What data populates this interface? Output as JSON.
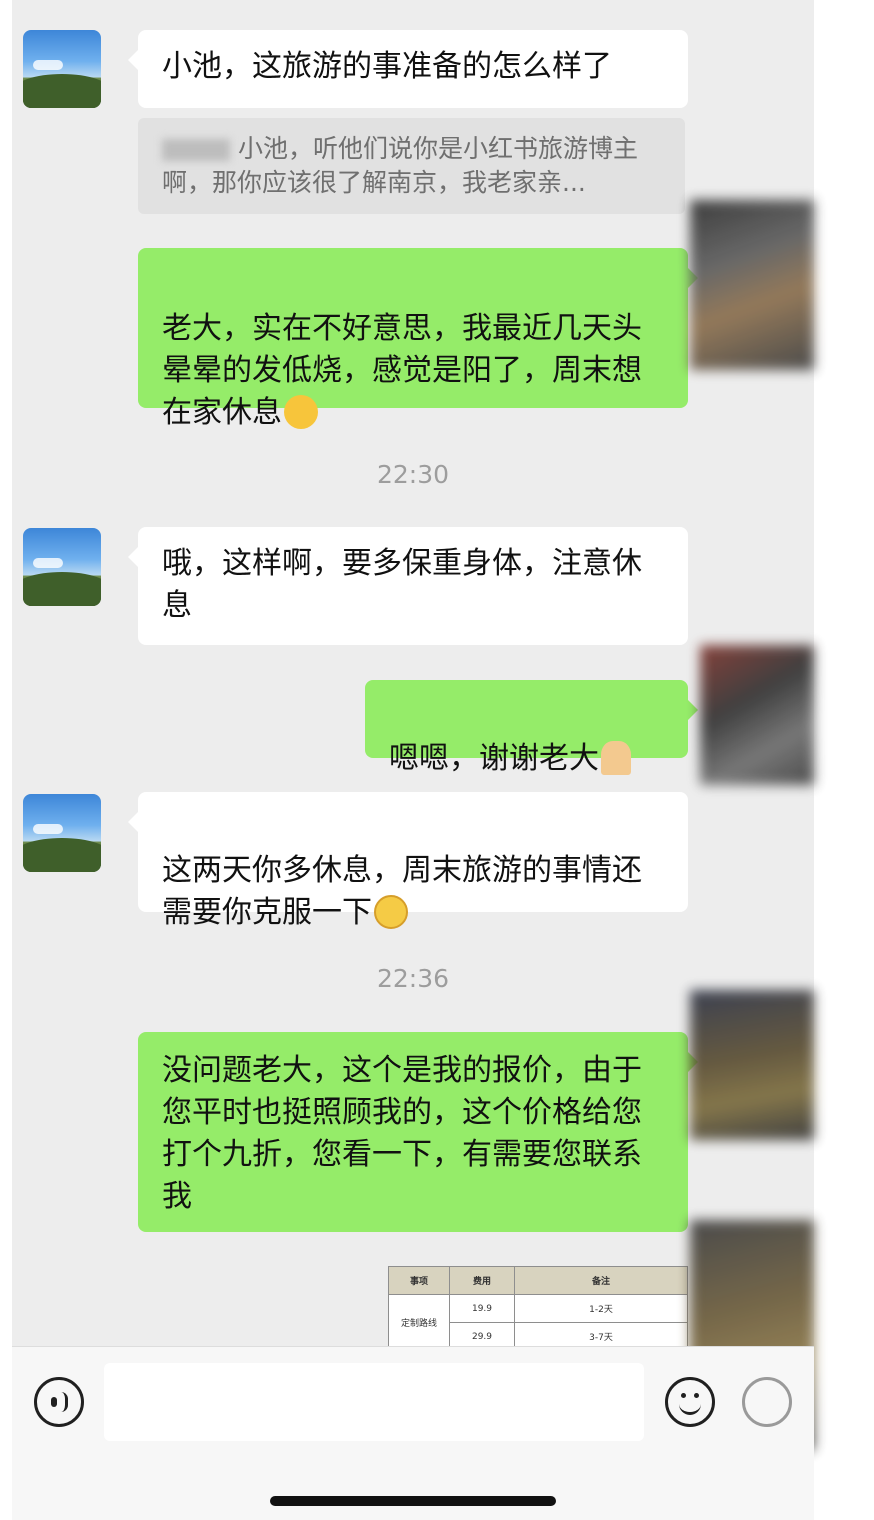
{
  "messages": {
    "m1": "小池，这旅游的事准备的怎么样了",
    "quote_text": "小池，听他们说你是小红书旅游博主啊，那你应该很了解南京，我老家亲...",
    "m2": "老大，实在不好意思，我最近几天头晕晕的发低烧，感觉是阳了，周末想在家休息",
    "time1": "22:30",
    "m3": "哦，这样啊，要多保重身体，注意休息",
    "m4": "嗯嗯，谢谢老大",
    "m5": "这两天你多休息，周末旅游的事情还需要你克服一下",
    "time2": "22:36",
    "m6": "没问题老大，这个是我的报价，由于您平时也挺照顾我的，这个价格给您打个九折，您看一下，有需要您联系我"
  },
  "price_table": {
    "headers": [
      "事项",
      "费用",
      "备注"
    ],
    "row_label": "定制路线",
    "rows": [
      {
        "fee": "19.9",
        "note": "1-2天"
      },
      {
        "fee": "29.9",
        "note": "3-7天"
      }
    ]
  },
  "colors": {
    "chat_background": "#ededed",
    "incoming_bubble": "#ffffff",
    "outgoing_bubble": "#95ec69"
  },
  "icons": {
    "voice": "voice-icon",
    "emoji": "emoji-icon",
    "more": "plus-icon"
  }
}
